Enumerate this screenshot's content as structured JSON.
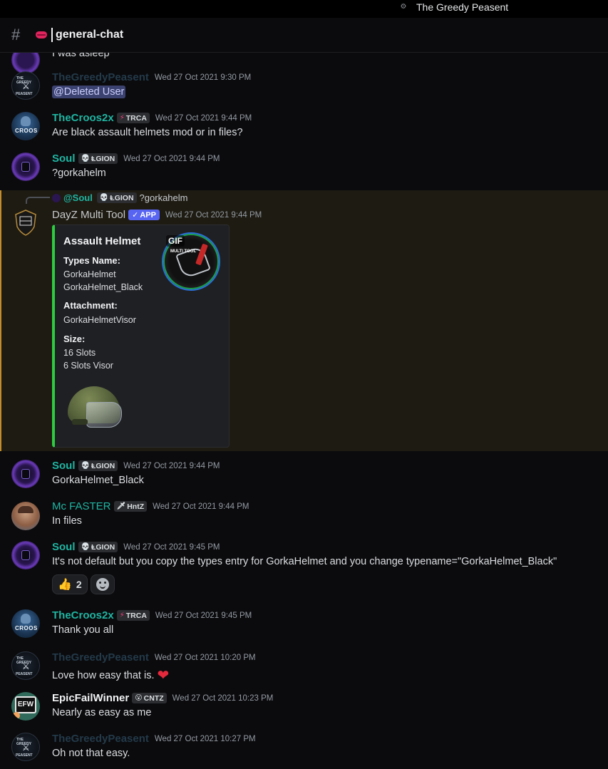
{
  "topbar": {
    "server_name": "The Greedy Peasent",
    "server_icon": "gear-icon"
  },
  "channel": {
    "emoji": "lips-icon",
    "name": "general-chat"
  },
  "colors": {
    "teal_name": "#1fb5a2",
    "dark_name": "#233a4a",
    "bright_name": "#f2f3f5",
    "app_badge": "#5865f2",
    "embed_border": "#2ecc40",
    "highlight_border": "#c48c2a",
    "heart": "#e5293c"
  },
  "messages": [
    {
      "id": "m0",
      "author": "",
      "text": "I was asleep"
    },
    {
      "id": "m1",
      "author": "TheGreedyPeasent",
      "timestamp": "Wed 27 Oct 2021 9:30 PM",
      "text": "@Deleted User"
    },
    {
      "id": "m2",
      "author": "TheCroos2x",
      "tag_icon": "⚡",
      "tag": "TRCA",
      "timestamp": "Wed 27 Oct 2021 9:44 PM",
      "text": "Are black assault helmets mod or in files?"
    },
    {
      "id": "m3",
      "author": "Soul",
      "tag_icon": "💀",
      "tag": "ⱠGION",
      "timestamp": "Wed 27 Oct 2021 9:44 PM",
      "text": "?gorkahelm"
    },
    {
      "id": "m4",
      "reply": {
        "author": "@Soul",
        "tag_icon": "💀",
        "tag": "ⱠGION",
        "text": "?gorkahelm"
      },
      "author": "DayZ Multi Tool",
      "badge": "APP",
      "timestamp": "Wed 27 Oct 2021 9:44 PM",
      "embed": {
        "title": "Assault Helmet",
        "thumbnail_badge": "GIF",
        "thumbnail_text": "MULTI TOOL",
        "fields": [
          {
            "name": "Types Name:",
            "values": [
              "GorkaHelmet",
              "GorkaHelmet_Black"
            ]
          },
          {
            "name": "Attachment:",
            "values": [
              "GorkaHelmetVisor"
            ]
          },
          {
            "name": "Size:",
            "values": [
              "16 Slots",
              "6 Slots Visor"
            ]
          }
        ]
      }
    },
    {
      "id": "m5",
      "author": "Soul",
      "tag_icon": "💀",
      "tag": "ⱠGION",
      "timestamp": "Wed 27 Oct 2021 9:44 PM",
      "text": "GorkaHelmet_Black"
    },
    {
      "id": "m6",
      "author": "Mc FASTER",
      "tag_icon": "🗡",
      "tag": "HntZ",
      "timestamp": "Wed 27 Oct 2021 9:44 PM",
      "text": "In files"
    },
    {
      "id": "m7",
      "author": "Soul",
      "tag_icon": "💀",
      "tag": "ⱠGION",
      "timestamp": "Wed 27 Oct 2021 9:45 PM",
      "text": "It's not default but you copy the types entry for GorkaHelmet and you change typename=\"GorkaHelmet_Black\"",
      "reactions": [
        {
          "emoji": "👍",
          "count": "2"
        }
      ]
    },
    {
      "id": "m8",
      "author": "TheCroos2x",
      "tag_icon": "⚡",
      "tag": "TRCA",
      "timestamp": "Wed 27 Oct 2021 9:45 PM",
      "text": "Thank you all"
    },
    {
      "id": "m9",
      "author": "TheGreedyPeasent",
      "timestamp": "Wed 27 Oct 2021 10:20 PM",
      "text": "Love how easy that is.",
      "emoji": "❤"
    },
    {
      "id": "m10",
      "author": "EpicFailWinner",
      "tag_icon": "😮",
      "tag": "CNTZ",
      "timestamp": "Wed 27 Oct 2021 10:23 PM",
      "text": "Nearly as easy as me"
    },
    {
      "id": "m11",
      "author": "TheGreedyPeasent",
      "timestamp": "Wed 27 Oct 2021 10:27 PM",
      "text": "Oh not that easy."
    }
  ],
  "avatars": {
    "greedy": {
      "line1": "THE GREEDY",
      "line2": "⚔",
      "line3": "PEASENT"
    },
    "croos": {
      "text": "CROOS"
    },
    "efw": {
      "text": "EFW"
    }
  }
}
